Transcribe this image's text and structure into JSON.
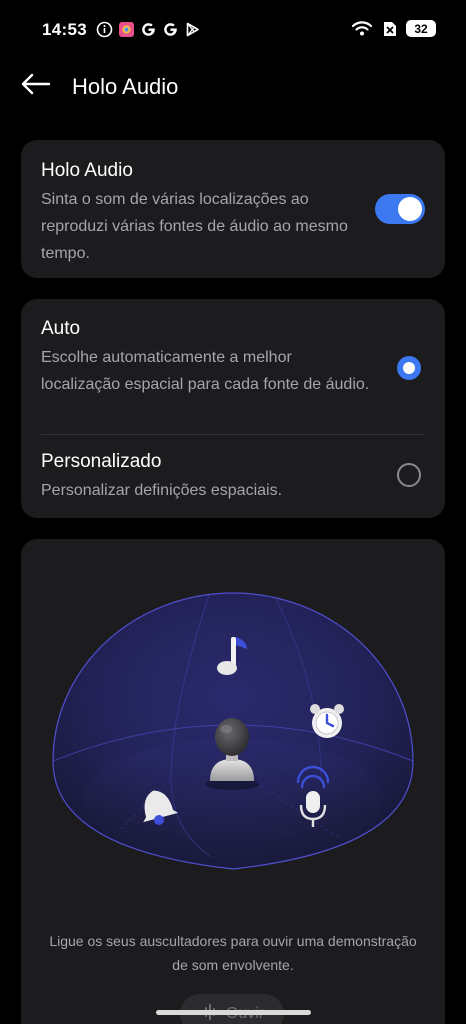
{
  "status_bar": {
    "time": "14:53",
    "battery": "32",
    "left_icons": [
      "info-icon",
      "photos-icon",
      "google-icon",
      "google-icon",
      "play-store-icon"
    ],
    "right_icons": [
      "wifi-icon",
      "sim-off-icon",
      "battery-icon"
    ]
  },
  "app_bar": {
    "title": "Holo Audio",
    "back_icon": "arrow-left-icon"
  },
  "holo_audio": {
    "title": "Holo Audio",
    "description": "Sinta o som de várias localizações ao reproduzi várias fontes de áudio ao mesmo tempo.",
    "enabled": true
  },
  "modes": [
    {
      "title": "Auto",
      "description": "Escolhe automaticamente a melhor localização espacial para cada fonte de áudio.",
      "selected": true
    },
    {
      "title": "Personalizado",
      "description": "Personalizar definições espaciais.",
      "selected": false
    }
  ],
  "demo": {
    "hint": "Ligue os seus auscultadores para ouvir uma demonstração de som envolvente.",
    "listen_label": "Ouvir",
    "icons": [
      "music-note-icon",
      "alarm-clock-icon",
      "person-icon",
      "bell-icon",
      "microphone-icon"
    ]
  },
  "colors": {
    "background": "#000000",
    "card": "#1c1c1e",
    "accent": "#3c79f0",
    "text_secondary": "#a6a6aa"
  }
}
